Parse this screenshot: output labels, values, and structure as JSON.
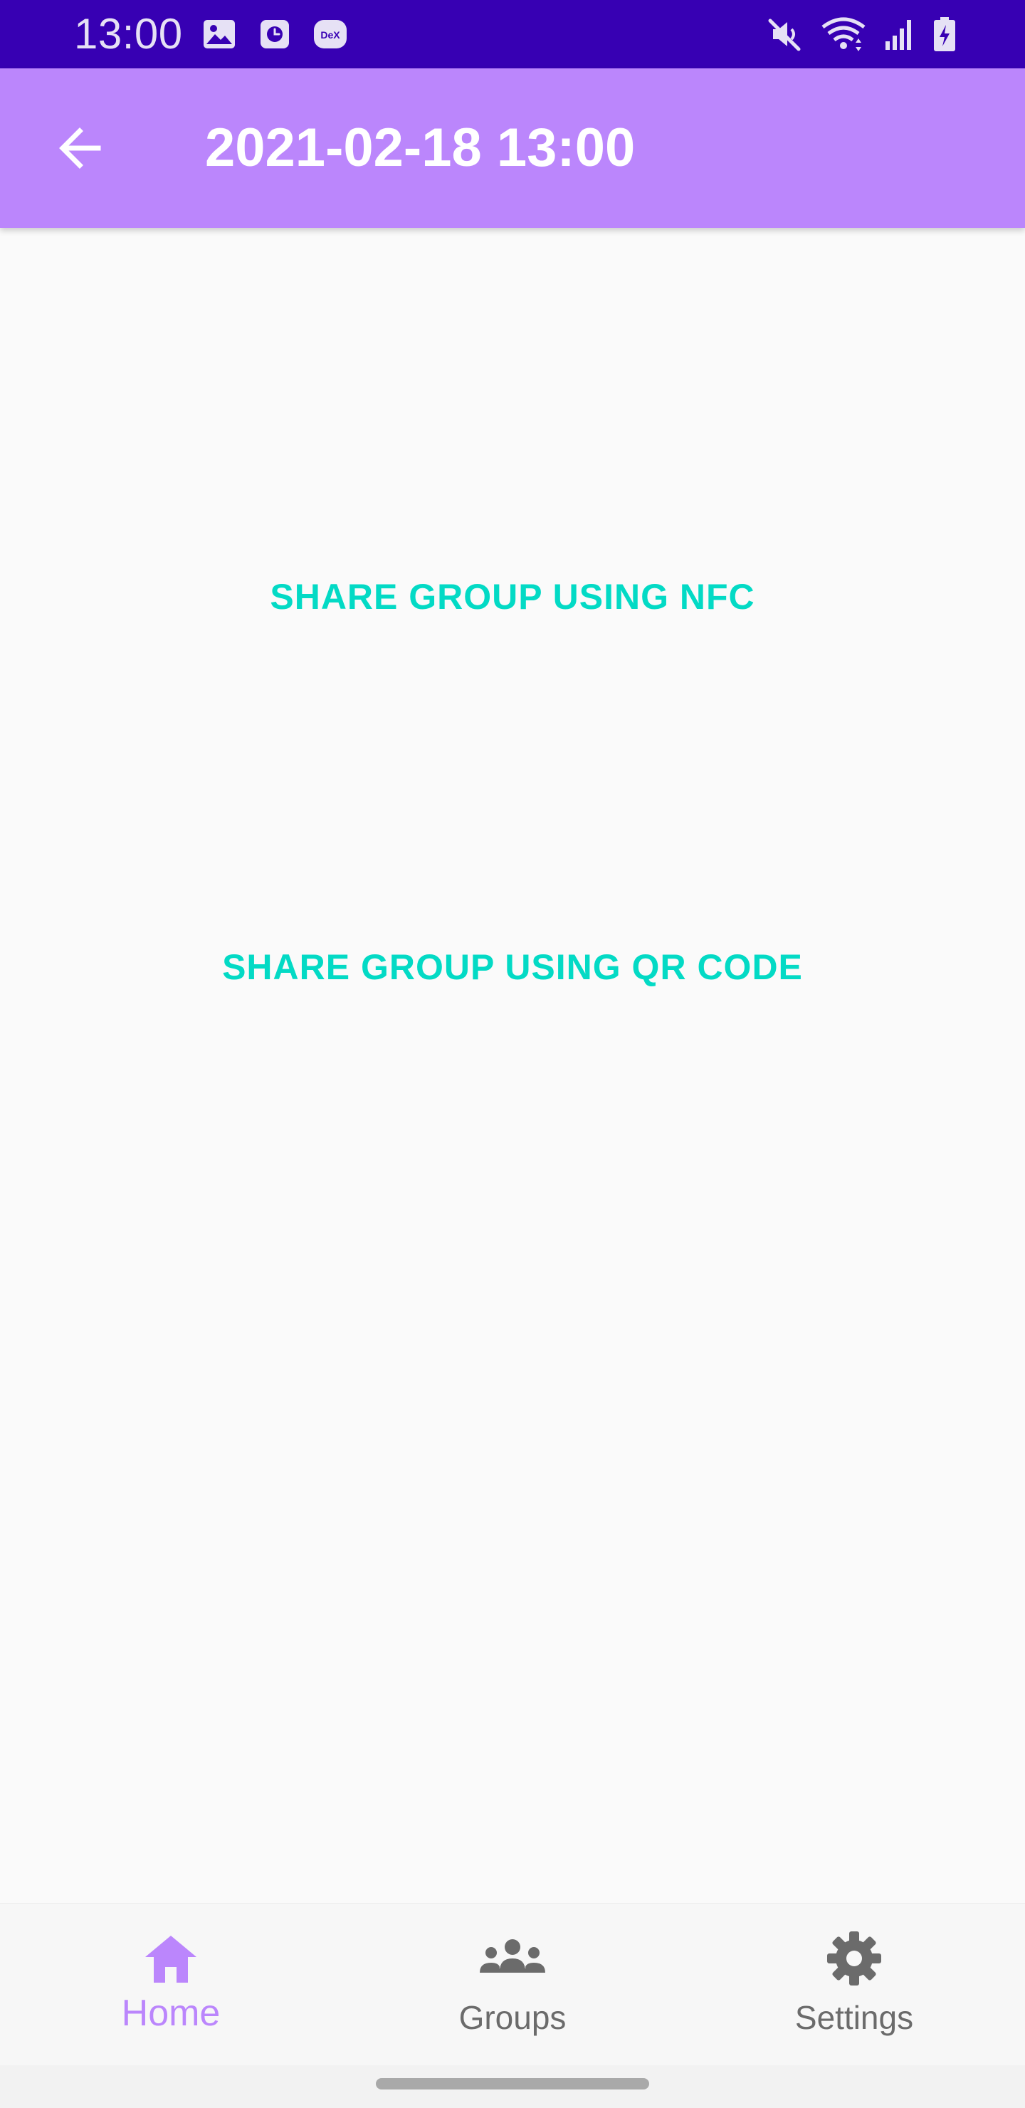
{
  "status_bar": {
    "time": "13:00",
    "left_icons": [
      "image-icon",
      "clock-app-icon",
      "dex-icon"
    ],
    "dex_label": "DeX",
    "right_icons": [
      "mute-icon",
      "wifi-icon",
      "signal-icon",
      "battery-charging-icon"
    ]
  },
  "app_bar": {
    "title": "2021-02-18 13:00",
    "back_icon": "arrow-back-icon"
  },
  "content": {
    "nfc_button_label": "SHARE GROUP USING NFC",
    "qr_button_label": "SHARE GROUP USING QR CODE"
  },
  "bottom_nav": {
    "items": [
      {
        "label": "Home",
        "icon": "home-icon",
        "active": true
      },
      {
        "label": "Groups",
        "icon": "groups-icon",
        "active": false
      },
      {
        "label": "Settings",
        "icon": "settings-gear-icon",
        "active": false
      }
    ]
  },
  "colors": {
    "status_bar": "#3700B3",
    "app_bar": "#BB86FC",
    "accent_text": "#03DAC5",
    "nav_active": "#BB86FC",
    "nav_inactive": "#6B6B6B"
  }
}
